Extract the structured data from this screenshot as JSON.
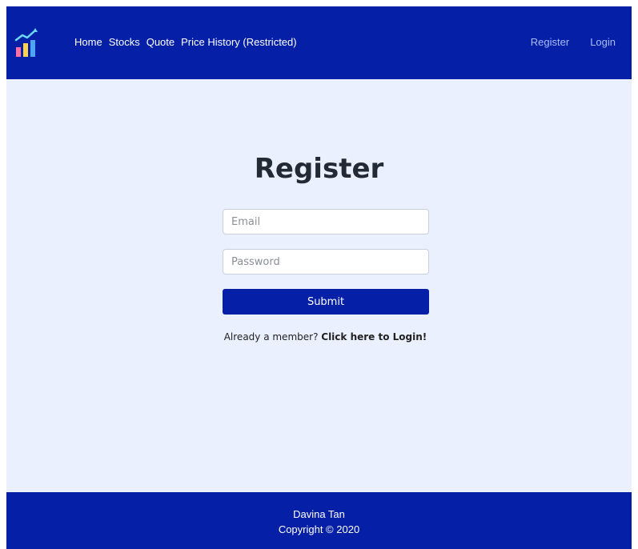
{
  "nav": {
    "links": [
      "Home",
      "Stocks",
      "Quote",
      "Price History (Restricted)"
    ],
    "register": "Register",
    "login": "Login"
  },
  "form": {
    "title": "Register",
    "email_placeholder": "Email",
    "password_placeholder": "Password",
    "submit": "Submit",
    "member_text": "Already a member?",
    "member_link": "Click here to Login!"
  },
  "footer": {
    "name": "Davina Tan",
    "copyright": "Copyright © 2020"
  },
  "colors": {
    "navbar": "#0520a6",
    "page_bg": "#eaf0fd",
    "auth_link": "#a9bdfd"
  },
  "icons": {
    "logo": "stock-chart-logo-icon"
  }
}
